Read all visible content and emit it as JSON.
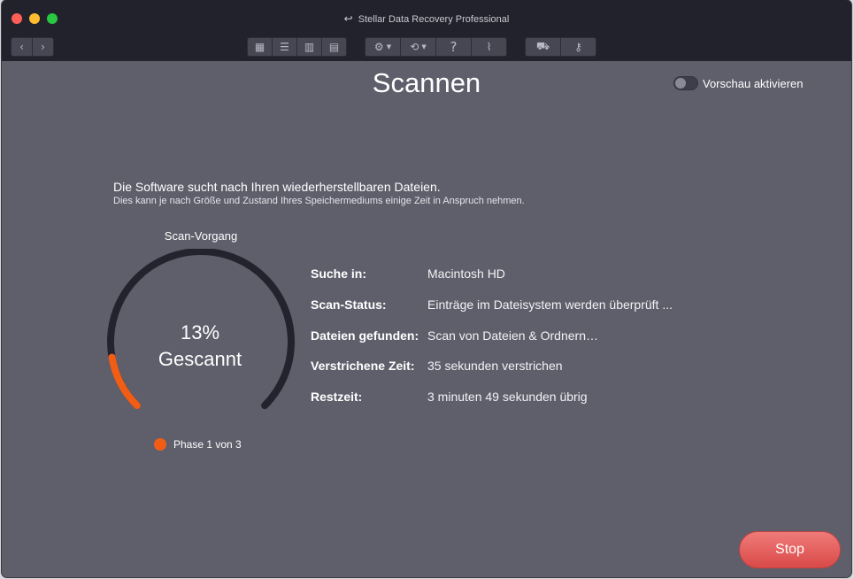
{
  "window": {
    "title": "Stellar Data Recovery Professional"
  },
  "toolbar": {
    "back_glyph": "‹",
    "forward_glyph": "›",
    "view_icons": [
      "▦",
      "☰",
      "▥",
      "▤"
    ],
    "settings_glyph": "⚙",
    "history_glyph": "⟲",
    "help_glyph": "?",
    "clean_glyph": "⌇",
    "cart_glyph": "⛟",
    "key_glyph": "⚷"
  },
  "page": {
    "heading": "Scannen",
    "preview_toggle_label": "Vorschau aktivieren",
    "description_main": "Die Software sucht nach Ihren wiederherstellbaren Dateien.",
    "description_sub": "Dies kann je nach Größe und Zustand Ihres Speichermediums einige Zeit in Anspruch nehmen."
  },
  "gauge": {
    "title": "Scan-Vorgang",
    "percent_text": "13%",
    "percent_value": 13,
    "status_word": "Gescannt",
    "phase_text": "Phase 1 von 3",
    "progress_color": "#f25d15",
    "track_color": "#23232e"
  },
  "info": [
    {
      "label": "Suche in:",
      "value": "Macintosh HD"
    },
    {
      "label": "Scan-Status:",
      "value": "Einträge im Dateisystem werden überprüft ..."
    },
    {
      "label": "Dateien gefunden:",
      "value": "Scan von Dateien & Ordnern…"
    },
    {
      "label": "Verstrichene Zeit:",
      "value": "35 sekunden verstrichen"
    },
    {
      "label": "Restzeit:",
      "value": "3 minuten 49 sekunden übrig"
    }
  ],
  "actions": {
    "stop_label": "Stop"
  }
}
